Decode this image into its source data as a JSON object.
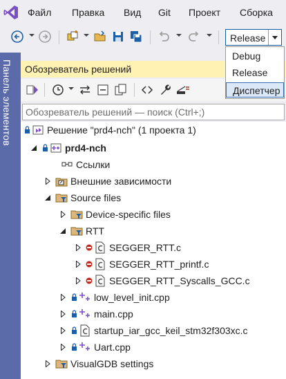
{
  "menu": [
    "Файл",
    "Правка",
    "Вид",
    "Git",
    "Проект",
    "Сборка"
  ],
  "toolbar": {
    "config_value": "Release",
    "config_options": [
      "Debug",
      "Release",
      "Диспетчер"
    ],
    "config_selected_index": 2
  },
  "side_tab_label": "Панель элементов",
  "solution_explorer": {
    "title": "Обозреватель решений",
    "search_placeholder": "Обозреватель решений — поиск (Ctrl+;)",
    "tree": [
      {
        "label": "Решение \"prd4-nch\"  (1 проекта 1)",
        "icon": "solution-icon",
        "expander": "none",
        "lock": true
      },
      {
        "label": "prd4-nch",
        "icon": "cpp-project-icon",
        "expander": "expanded",
        "lock": true,
        "bold": true
      },
      {
        "label": "Ссылки",
        "icon": "references-icon",
        "expander": "none"
      },
      {
        "label": "Внешние зависимости",
        "icon": "external-deps-icon",
        "expander": "collapsed"
      },
      {
        "label": "Source files",
        "icon": "filter-folder-icon",
        "expander": "expanded"
      },
      {
        "label": "Device-specific files",
        "icon": "filter-folder-icon",
        "expander": "collapsed"
      },
      {
        "label": "RTT",
        "icon": "filter-folder-icon",
        "expander": "expanded"
      },
      {
        "label": "SEGGER_RTT.c",
        "icon": "c-file-icon",
        "expander": "collapsed",
        "excluded": true
      },
      {
        "label": "SEGGER_RTT_printf.c",
        "icon": "c-file-icon",
        "expander": "collapsed",
        "excluded": true
      },
      {
        "label": "SEGGER_RTT_Syscalls_GCC.c",
        "icon": "c-file-icon",
        "expander": "collapsed",
        "excluded": true
      },
      {
        "label": "low_level_init.cpp",
        "icon": "cpp-file-icon",
        "expander": "collapsed",
        "lock": true
      },
      {
        "label": "main.cpp",
        "icon": "cpp-file-icon",
        "expander": "collapsed",
        "lock": true
      },
      {
        "label": "startup_iar_gcc_keil_stm32f303xc.c",
        "icon": "c-file-icon",
        "expander": "collapsed",
        "lock": true
      },
      {
        "label": "Uart.cpp",
        "icon": "cpp-file-icon",
        "expander": "collapsed",
        "lock": true
      },
      {
        "label": "VisualGDB settings",
        "icon": "filter-folder-icon",
        "expander": "collapsed"
      }
    ]
  }
}
